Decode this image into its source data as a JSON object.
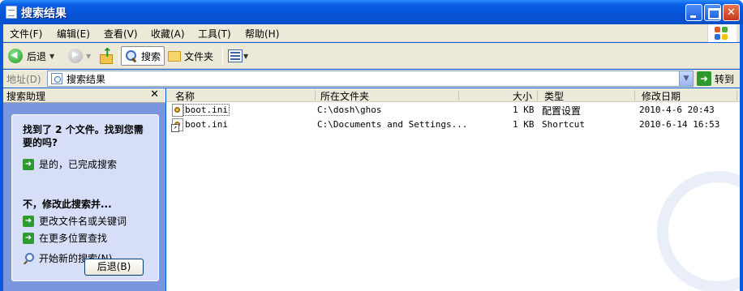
{
  "window": {
    "title": "搜索结果",
    "controls": [
      "minimize",
      "maximize",
      "close"
    ]
  },
  "menubar": {
    "items": [
      "文件(F)",
      "编辑(E)",
      "查看(V)",
      "收藏(A)",
      "工具(T)",
      "帮助(H)"
    ]
  },
  "toolbar": {
    "back_label": "后退",
    "search_label": "搜索",
    "folders_label": "文件夹"
  },
  "address": {
    "label": "地址(D)",
    "value": "搜索结果",
    "go_label": "转到"
  },
  "assistant": {
    "header": "搜索助理",
    "close_glyph": "✕",
    "question": "找到了 2 个文件。找到您需要的吗?",
    "option_yes": "是的，已完成搜索",
    "refine_heading": "不，修改此搜索并...",
    "option_change": "更改文件名或关键词",
    "option_more": "在更多位置查找",
    "new_search": "开始新的搜索(N)",
    "back_button": "后退(B)"
  },
  "filelist": {
    "columns": [
      "名称",
      "所在文件夹",
      "大小",
      "类型",
      "修改日期"
    ],
    "rows": [
      {
        "name": "boot.ini",
        "folder": "C:\\dosh\\ghos",
        "size": "1 KB",
        "type": "配置设置",
        "modified": "2010-4-6 20:43"
      },
      {
        "name": "boot.ini",
        "folder": "C:\\Documents and Settings...",
        "size": "1 KB",
        "type": "Shortcut",
        "modified": "2010-6-14 16:53"
      }
    ]
  },
  "colors": {
    "titlebar": "#0552d6",
    "chrome": "#ece9d8",
    "assistant_bg": "#7a96df",
    "assistant_panel": "#d6dff7"
  }
}
